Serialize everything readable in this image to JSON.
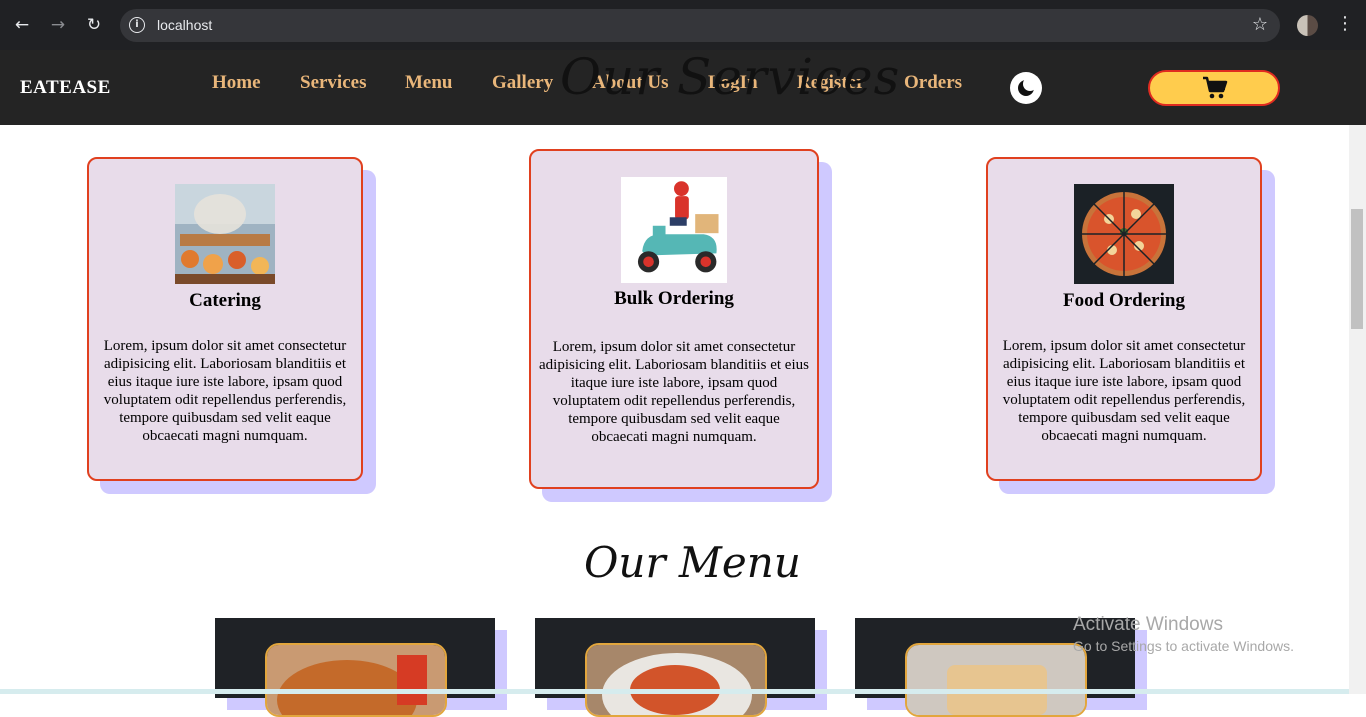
{
  "browser": {
    "url": "localhost",
    "back_icon": "←",
    "forward_icon": "→",
    "reload_icon": "↻",
    "star_icon": "☆",
    "menu_icon": "⋮"
  },
  "header": {
    "logo": "EATEASE",
    "nav": [
      "Home",
      "Services",
      "Menu",
      "Gallery",
      "About Us",
      "LogIn",
      "Register",
      "Orders"
    ]
  },
  "services": {
    "title": "Our Services",
    "cards": [
      {
        "title": "Catering",
        "text": "Lorem, ipsum dolor sit amet consectetur adipisicing elit. Laboriosam blanditiis et eius itaque iure iste labore, ipsam quod voluptatem odit repellendus perferendis, tempore quibusdam sed velit eaque obcaecati magni numquam."
      },
      {
        "title": "Bulk Ordering",
        "text": "Lorem, ipsum dolor sit amet consectetur adipisicing elit. Laboriosam blanditiis et eius itaque iure iste labore, ipsam quod voluptatem odit repellendus perferendis, tempore quibusdam sed velit eaque obcaecati magni numquam."
      },
      {
        "title": "Food Ordering",
        "text": "Lorem, ipsum dolor sit amet consectetur adipisicing elit. Laboriosam blanditiis et eius itaque iure iste labore, ipsam quod voluptatem odit repellendus perferendis, tempore quibusdam sed velit eaque obcaecati magni numquam."
      }
    ]
  },
  "menu": {
    "title": "Our Menu"
  },
  "os_watermark": {
    "line1": "Activate Windows",
    "line2": "Go to Settings to activate Windows."
  },
  "colors": {
    "header_bg": "#242424",
    "nav_link": "#e9b67a",
    "card_bg": "#e8dcea",
    "card_border": "#e0401f",
    "card_shadow": "#cfc9ff",
    "cart_button": "#ffcc4d"
  }
}
